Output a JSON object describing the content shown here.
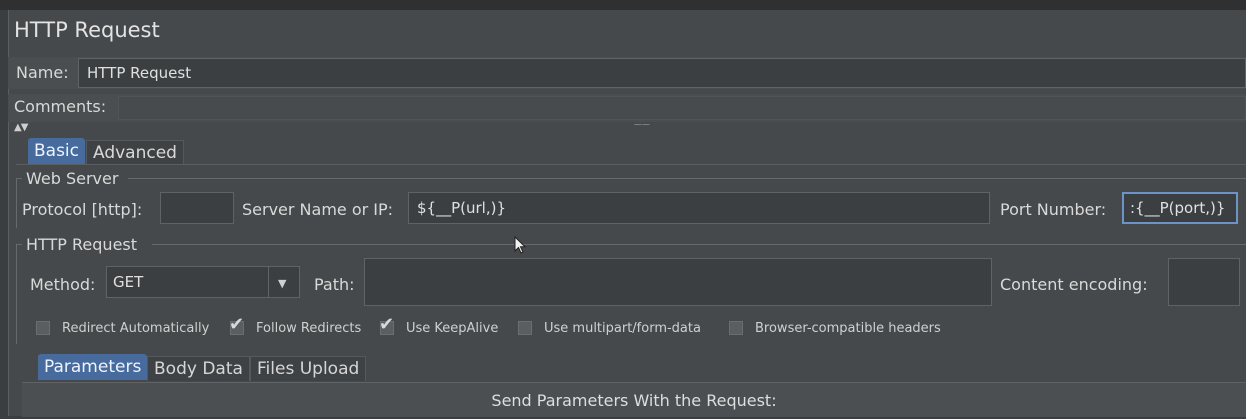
{
  "panel": {
    "title": "HTTP Request"
  },
  "name_row": {
    "label": "Name:",
    "value": "HTTP Request"
  },
  "comments_row": {
    "label": "Comments:",
    "value": ""
  },
  "tabs": [
    {
      "label": "Basic",
      "active": true
    },
    {
      "label": "Advanced",
      "active": false
    }
  ],
  "web_server": {
    "legend": "Web Server",
    "protocol_label": "Protocol [http]:",
    "protocol_value": "",
    "server_label": "Server Name or IP:",
    "server_value": "${__P(url,)}",
    "port_label": "Port Number:",
    "port_value": ":{__P(port,)}"
  },
  "http_request": {
    "legend": "HTTP Request",
    "method_label": "Method:",
    "method_value": "GET",
    "path_label": "Path:",
    "path_value": "",
    "encoding_label": "Content encoding:",
    "encoding_value": ""
  },
  "options": [
    {
      "label": "Redirect Automatically",
      "checked": false
    },
    {
      "label": "Follow Redirects",
      "checked": true
    },
    {
      "label": "Use KeepAlive",
      "checked": true
    },
    {
      "label": "Use multipart/form-data",
      "checked": false
    },
    {
      "label": "Browser-compatible headers",
      "checked": false
    }
  ],
  "subtabs": [
    {
      "label": "Parameters",
      "active": true
    },
    {
      "label": "Body Data",
      "active": false
    },
    {
      "label": "Files Upload",
      "active": false
    }
  ],
  "params": {
    "header": "Send Parameters With the Request:"
  },
  "colors": {
    "accent": "#466b9c",
    "panel": "#45494b",
    "field": "#3c3f41"
  }
}
